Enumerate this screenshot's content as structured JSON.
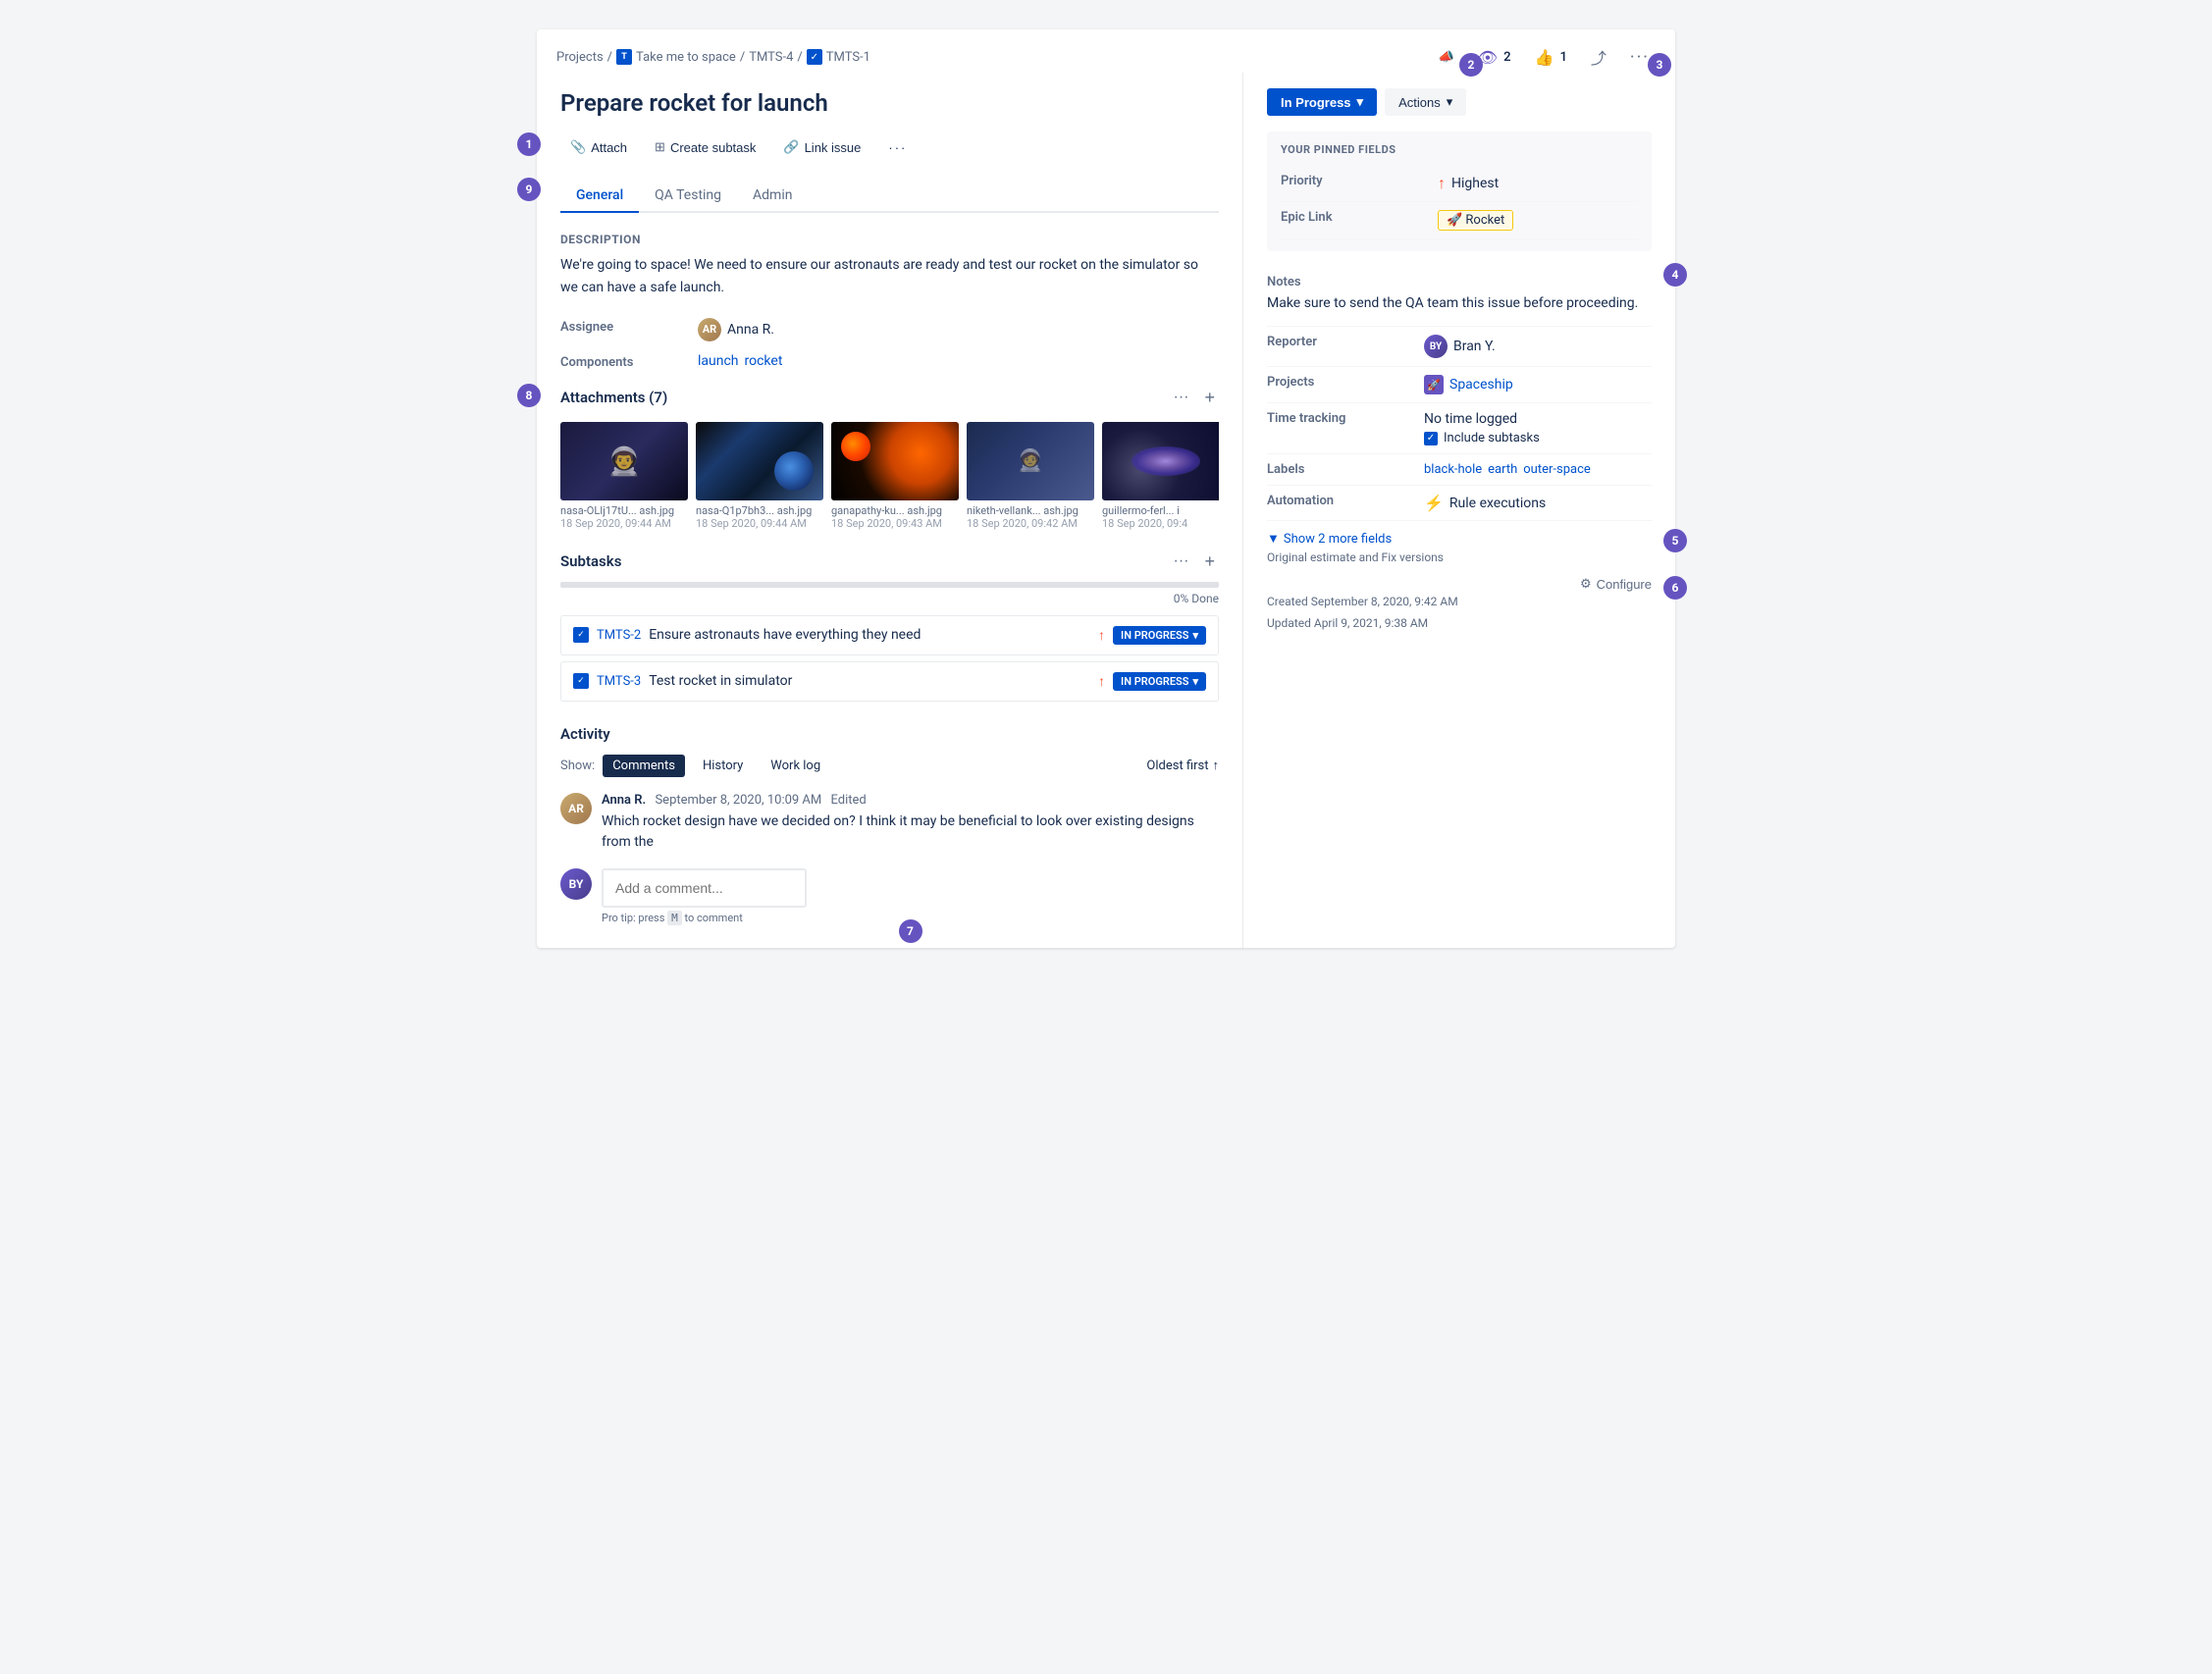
{
  "breadcrumb": {
    "projects": "Projects",
    "sep1": "/",
    "space_project": "Take me to space",
    "sep2": "/",
    "parent_issue": "TMTS-4",
    "sep3": "/",
    "current_issue": "TMTS-1"
  },
  "top_actions": {
    "megaphone_icon": "📣",
    "watch_count": "2",
    "like_count": "1",
    "share_icon": "🔗",
    "more_icon": "···"
  },
  "status": {
    "label": "In Progress",
    "dropdown_icon": "▾"
  },
  "actions_btn": {
    "label": "Actions",
    "dropdown_icon": "▾"
  },
  "issue": {
    "title": "Prepare rocket for launch",
    "description_label": "Description",
    "description_text": "We're going to space! We need to ensure our astronauts are ready and test our rocket on the simulator so we can have a safe launch."
  },
  "toolbar": {
    "attach_label": "Attach",
    "subtask_label": "Create subtask",
    "link_label": "Link issue",
    "more_label": "···"
  },
  "tabs": [
    {
      "id": "general",
      "label": "General",
      "active": true
    },
    {
      "id": "qa",
      "label": "QA Testing",
      "active": false
    },
    {
      "id": "admin",
      "label": "Admin",
      "active": false
    }
  ],
  "fields": {
    "assignee_label": "Assignee",
    "assignee_value": "Anna R.",
    "components_label": "Components",
    "components": [
      "launch",
      "rocket"
    ]
  },
  "attachments": {
    "title": "Attachments (7)",
    "items": [
      {
        "name": "nasa-OLIj17tU... ash.jpg",
        "date": "18 Sep 2020, 09:44 AM",
        "type": "astronaut"
      },
      {
        "name": "nasa-Q1p7bh3... ash.jpg",
        "date": "18 Sep 2020, 09:44 AM",
        "type": "earth"
      },
      {
        "name": "ganapathy-ku... ash.jpg",
        "date": "18 Sep 2020, 09:43 AM",
        "type": "moon"
      },
      {
        "name": "niketh-vellank... ash.jpg",
        "date": "18 Sep 2020, 09:42 AM",
        "type": "astronaut2"
      },
      {
        "name": "guillermo-ferl... i",
        "date": "18 Sep 2020, 09:4",
        "type": "galaxy"
      }
    ]
  },
  "subtasks": {
    "title": "Subtasks",
    "progress_percent": "0% Done",
    "progress_value": 0,
    "items": [
      {
        "id": "TMTS-2",
        "name": "Ensure astronauts have everything they need",
        "status": "IN PROGRESS"
      },
      {
        "id": "TMTS-3",
        "name": "Test rocket in simulator",
        "status": "IN PROGRESS"
      }
    ]
  },
  "activity": {
    "title": "Activity",
    "show_label": "Show:",
    "tabs": [
      {
        "label": "Comments",
        "active": true
      },
      {
        "label": "History",
        "active": false
      },
      {
        "label": "Work log",
        "active": false
      }
    ],
    "sort_label": "Oldest first",
    "sort_icon": "↑",
    "comments": [
      {
        "author": "Anna R.",
        "date": "September 8, 2020, 10:09 AM",
        "edited": "Edited",
        "text": "Which rocket design have we decided on? I think it may be beneficial to look over existing designs from the"
      }
    ],
    "add_comment_placeholder": "Add a comment...",
    "pro_tip": "Pro tip: press",
    "pro_tip_key": "M",
    "pro_tip_suffix": "to comment"
  },
  "right_panel": {
    "pinned_fields_label": "YOUR PINNED FIELDS",
    "priority_label": "Priority",
    "priority_value": "Highest",
    "epic_link_label": "Epic Link",
    "epic_link_value": "🚀 Rocket",
    "notes_label": "Notes",
    "notes_text": "Make sure to send the QA team this issue before proceeding.",
    "reporter_label": "Reporter",
    "reporter_value": "Bran Y.",
    "projects_label": "Projects",
    "projects_value": "Spaceship",
    "time_tracking_label": "Time tracking",
    "time_tracking_value": "No time logged",
    "include_subtasks": "Include subtasks",
    "labels_label": "Labels",
    "labels": [
      "black-hole",
      "earth",
      "outer-space"
    ],
    "automation_label": "Automation",
    "automation_value": "Rule executions",
    "show_more_label": "Show 2 more fields",
    "show_more_sub": "Original estimate and Fix versions",
    "created_label": "Created",
    "created_value": "September 8, 2020, 9:42 AM",
    "updated_label": "Updated",
    "updated_value": "April 9, 2021, 9:38 AM",
    "configure_label": "Configure"
  },
  "callouts": {
    "c1": "1",
    "c2": "2",
    "c3": "3",
    "c4": "4",
    "c5": "5",
    "c6": "6",
    "c7": "7",
    "c8": "8",
    "c9": "9"
  }
}
